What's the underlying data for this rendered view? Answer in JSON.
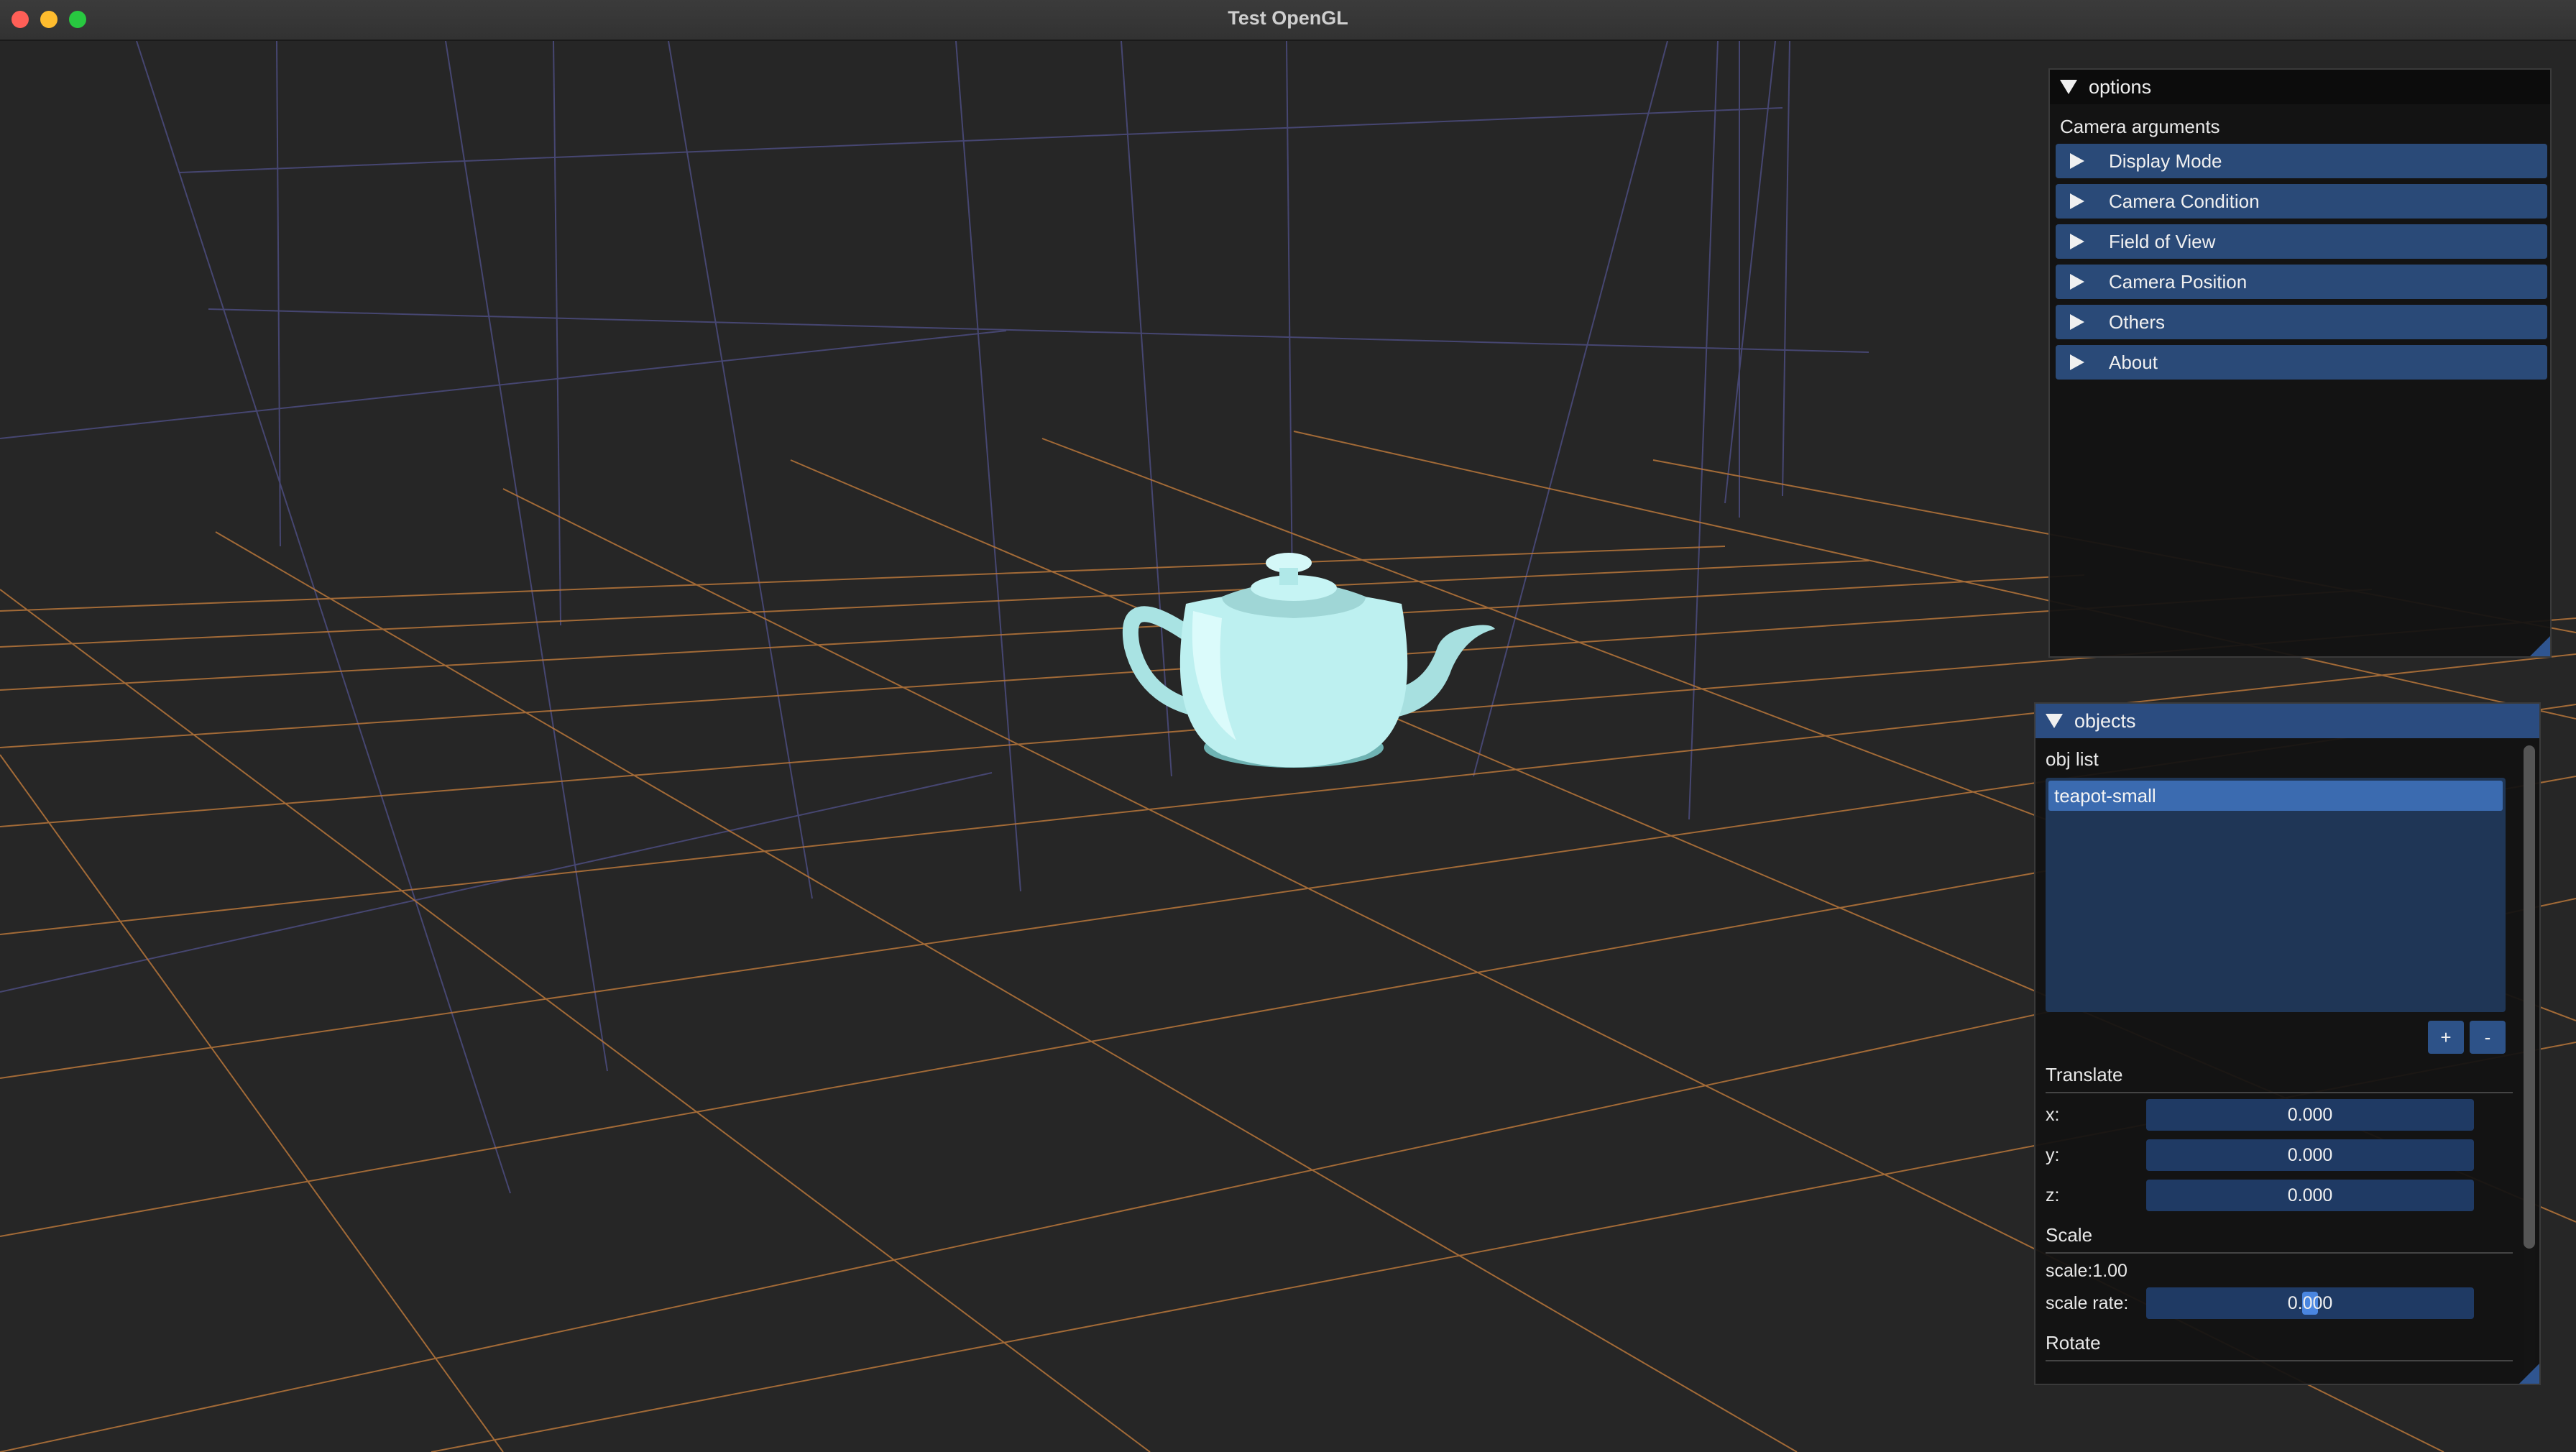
{
  "window": {
    "title": "Test OpenGL"
  },
  "options": {
    "header": "options",
    "section": "Camera arguments",
    "items": [
      {
        "label": "Display Mode"
      },
      {
        "label": "Camera Condition"
      },
      {
        "label": "Field of View"
      },
      {
        "label": "Camera Position"
      },
      {
        "label": "Others"
      },
      {
        "label": "About"
      }
    ]
  },
  "objects": {
    "header": "objects",
    "list_label": "obj list",
    "list": [
      {
        "name": "teapot-small",
        "selected": true
      }
    ],
    "add_label": "+",
    "remove_label": "-",
    "translate": {
      "title": "Translate",
      "x_label": "x:",
      "x_value": "0.000",
      "y_label": "y:",
      "y_value": "0.000",
      "z_label": "z:",
      "z_value": "0.000"
    },
    "scale": {
      "title": "Scale",
      "current": "scale:1.00",
      "rate_label": "scale rate:",
      "rate_value": "0.000",
      "rate_level": 0.5
    },
    "rotate": {
      "title": "Rotate"
    }
  },
  "colors": {
    "background": "#262626",
    "grid_floor": "#b8763a",
    "grid_wall": "#4a4a7a",
    "teapot": "#bdf0f0",
    "accent": "#2a4a78",
    "selection": "#3b6bb0"
  }
}
